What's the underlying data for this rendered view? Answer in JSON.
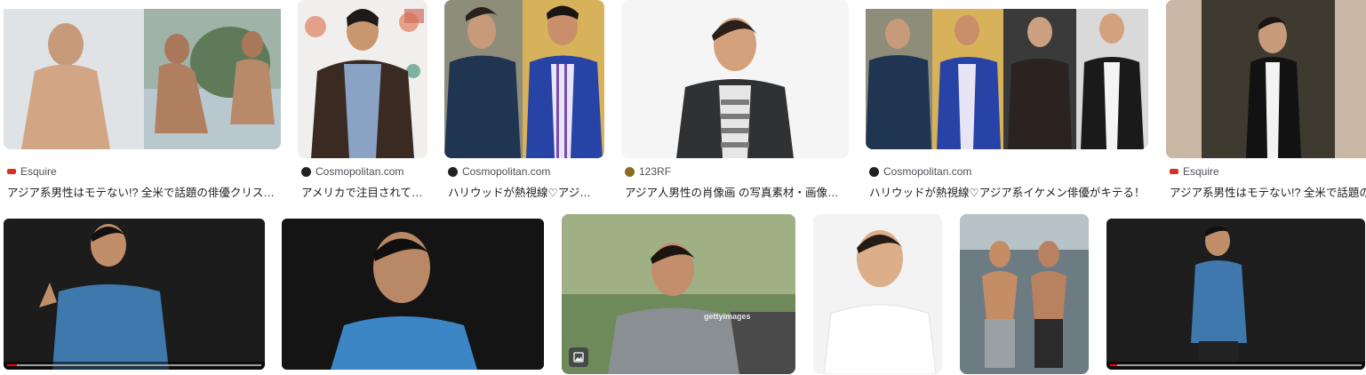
{
  "row1": [
    {
      "source": "Esquire",
      "favicon_color": "#d93025",
      "title": "アジア系男性はモテない!? 全米で話題の俳優クリス・パン"
    },
    {
      "source": "Cosmopolitan.com",
      "favicon_color": "#202124",
      "title": "アメリカで注目されている"
    },
    {
      "source": "Cosmopolitan.com",
      "favicon_color": "#202124",
      "title": "ハリウッドが熱視線♡アジア系"
    },
    {
      "source": "123RF",
      "favicon_color": "#8a6d1e",
      "title": "アジア人男性の肖像画 の写真素材・画像素材"
    },
    {
      "source": "Cosmopolitan.com",
      "favicon_color": "#202124",
      "title": "ハリウッドが熱視線♡アジア系イケメン俳優がキテる！"
    },
    {
      "source": "Esquire",
      "favicon_color": "#d93025",
      "title": "アジア系男性はモテない!? 全米で話題の俳優"
    }
  ],
  "row2": [
    {
      "kind": "video"
    },
    {
      "kind": "video"
    },
    {
      "kind": "photo",
      "watermark": "gettyimages"
    },
    {
      "kind": "photo"
    },
    {
      "kind": "photo"
    },
    {
      "kind": "video"
    }
  ]
}
